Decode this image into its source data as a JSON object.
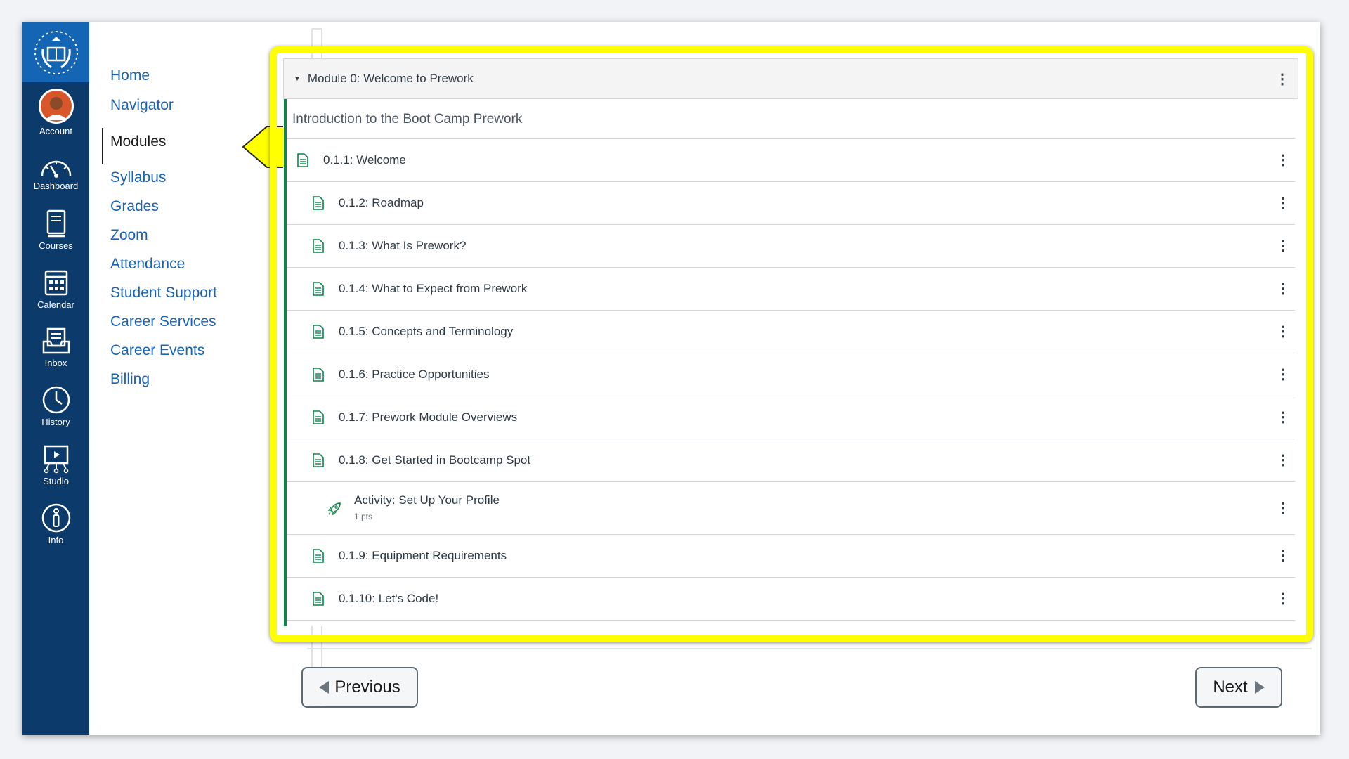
{
  "global_nav": {
    "items": [
      {
        "label": "Account",
        "icon": "account-avatar"
      },
      {
        "label": "Dashboard",
        "icon": "dashboard-icon"
      },
      {
        "label": "Courses",
        "icon": "courses-icon"
      },
      {
        "label": "Calendar",
        "icon": "calendar-icon"
      },
      {
        "label": "Inbox",
        "icon": "inbox-icon"
      },
      {
        "label": "History",
        "icon": "history-icon"
      },
      {
        "label": "Studio",
        "icon": "studio-icon"
      },
      {
        "label": "Info",
        "icon": "info-icon"
      }
    ]
  },
  "course_nav": {
    "links": [
      {
        "label": "Home"
      },
      {
        "label": "Navigator"
      },
      {
        "label": "Modules",
        "active": true
      },
      {
        "label": "Syllabus"
      },
      {
        "label": "Grades"
      },
      {
        "label": "Zoom"
      },
      {
        "label": "Attendance"
      },
      {
        "label": "Student Support"
      },
      {
        "label": "Career Services"
      },
      {
        "label": "Career Events"
      },
      {
        "label": "Billing"
      }
    ]
  },
  "module": {
    "title": "Module 0: Welcome to Prework",
    "subheader": "Introduction to the  Boot Camp Prework",
    "items": [
      {
        "label": "0.1.1: Welcome",
        "type": "page"
      },
      {
        "label": "0.1.2: Roadmap",
        "type": "page"
      },
      {
        "label": "0.1.3: What Is Prework?",
        "type": "page"
      },
      {
        "label": "0.1.4: What to Expect from Prework",
        "type": "page"
      },
      {
        "label": "0.1.5: Concepts and Terminology",
        "type": "page"
      },
      {
        "label": "0.1.6: Practice Opportunities",
        "type": "page"
      },
      {
        "label": "0.1.7: Prework Module Overviews",
        "type": "page"
      },
      {
        "label": "0.1.8: Get Started in Bootcamp Spot",
        "type": "page"
      },
      {
        "label": "Activity: Set Up Your Profile",
        "type": "assignment",
        "points": "1 pts"
      },
      {
        "label": "0.1.9: Equipment Requirements",
        "type": "page"
      },
      {
        "label": "0.1.10: Let's Code!",
        "type": "page"
      }
    ]
  },
  "footer": {
    "previous_label": "Previous",
    "next_label": "Next"
  },
  "colors": {
    "global_nav_bg": "#0c3a6a",
    "logo_bg": "#1565b5",
    "link": "#1a63b4",
    "highlight": "#ffff00",
    "module_accent": "#0b874b"
  }
}
